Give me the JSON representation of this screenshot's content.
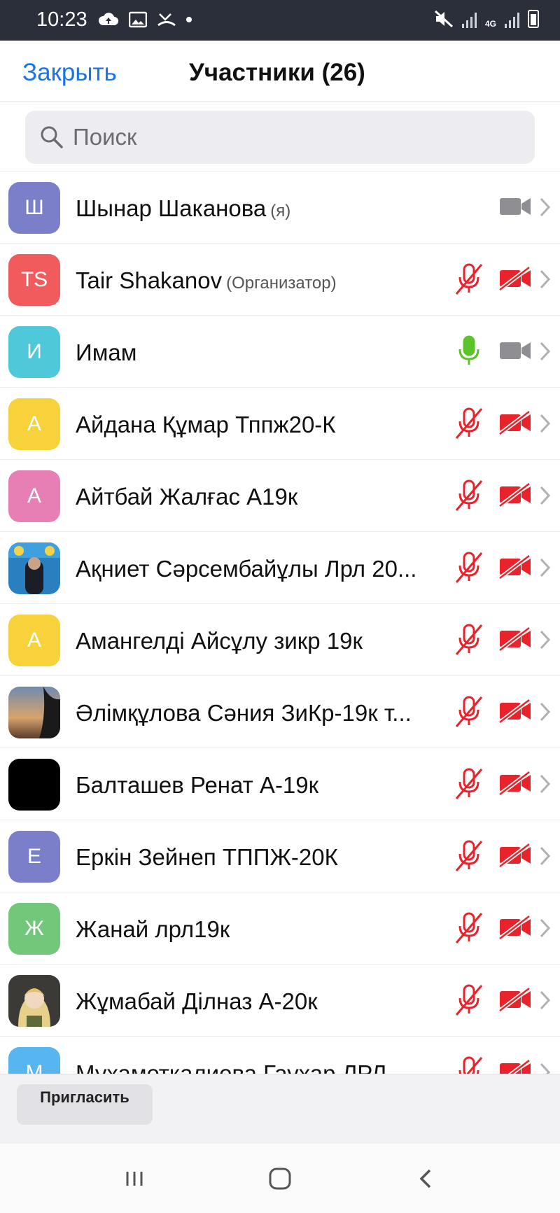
{
  "status_bar": {
    "time": "10:23",
    "network": "4G"
  },
  "header": {
    "close_label": "Закрыть",
    "title": "Участники (26)"
  },
  "search": {
    "placeholder": "Поиск"
  },
  "colors": {
    "accent": "#1a73e8",
    "muted_red": "#e8232c",
    "mic_on_green": "#5cc32a",
    "icon_gray": "#8e8e93"
  },
  "participants": [
    {
      "initials": "Ш",
      "avatar_color": "#7b7fc9",
      "name": "Шынар Шаканова",
      "role": "(я)",
      "mic": "none",
      "camera": "on"
    },
    {
      "initials": "TS",
      "avatar_color": "#f25b5d",
      "name": "Tair Shakanov",
      "role": "(Организатор)",
      "mic": "muted",
      "camera": "off"
    },
    {
      "initials": "И",
      "avatar_color": "#4fc8da",
      "name": "Имам",
      "role": "",
      "mic": "on",
      "camera": "on"
    },
    {
      "initials": "А",
      "avatar_color": "#f7d23a",
      "name": "Айдана Құмар Тппж20-К",
      "role": "",
      "mic": "muted",
      "camera": "off"
    },
    {
      "initials": "А",
      "avatar_color": "#e77fb4",
      "name": "Айтбай Жалғас А19к",
      "role": "",
      "mic": "muted",
      "camera": "off"
    },
    {
      "initials": "",
      "avatar_color": "photo",
      "name": "Ақниет Сәрсембайұлы Лрл 20...",
      "role": "",
      "mic": "muted",
      "camera": "off"
    },
    {
      "initials": "А",
      "avatar_color": "#f7d23a",
      "name": "Амангелді Айсұлу зикр 19к",
      "role": "",
      "mic": "muted",
      "camera": "off"
    },
    {
      "initials": "",
      "avatar_color": "photo",
      "name": "Әлімқұлова Сәния ЗиКр-19к т...",
      "role": "",
      "mic": "muted",
      "camera": "off"
    },
    {
      "initials": "",
      "avatar_color": "#000000",
      "name": "Балташев Ренат А-19к",
      "role": "",
      "mic": "muted",
      "camera": "off"
    },
    {
      "initials": "Е",
      "avatar_color": "#7b7fc9",
      "name": "Еркін Зейнеп ТППЖ-20К",
      "role": "",
      "mic": "muted",
      "camera": "off"
    },
    {
      "initials": "Ж",
      "avatar_color": "#73c77a",
      "name": "Жанай лрл19к",
      "role": "",
      "mic": "muted",
      "camera": "off"
    },
    {
      "initials": "",
      "avatar_color": "photo",
      "name": "Жұмабай Ділназ А-20к",
      "role": "",
      "mic": "muted",
      "camera": "off"
    },
    {
      "initials": "М",
      "avatar_color": "#57b6ef",
      "name": "Мухаметкалиева Гаухар ЛРЛ",
      "role": "",
      "mic": "muted",
      "camera": "off"
    }
  ],
  "bottom_bar": {
    "invite_label": "Пригласить"
  },
  "nav": {
    "items": [
      "recent-apps",
      "home",
      "back"
    ]
  }
}
